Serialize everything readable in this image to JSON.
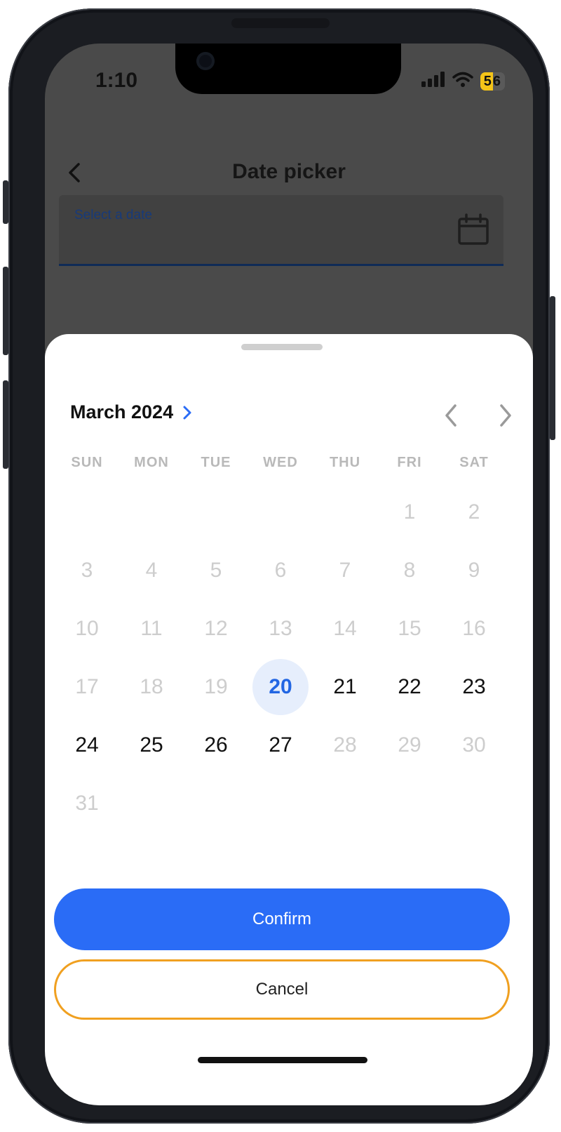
{
  "status_bar": {
    "time": "1:10",
    "battery_percent": "5",
    "battery_rest": "6",
    "signal_icon": "cellular-signal-icon",
    "wifi_icon": "wifi-icon"
  },
  "app_bar": {
    "title": "Date picker",
    "back_icon": "chevron-left-icon"
  },
  "date_field": {
    "label": "Select a date",
    "icon": "calendar-icon"
  },
  "colors": {
    "accent": "#2a6cf6",
    "selected_bg": "#e6eefc",
    "cancel_border": "#f0a020"
  },
  "picker": {
    "month_label": "March 2024",
    "weekdays": [
      "SUN",
      "MON",
      "TUE",
      "WED",
      "THU",
      "FRI",
      "SAT"
    ],
    "days": {
      "d1": "1",
      "d2": "2",
      "d3": "3",
      "d4": "4",
      "d5": "5",
      "d6": "6",
      "d7": "7",
      "d8": "8",
      "d9": "9",
      "d10": "10",
      "d11": "11",
      "d12": "12",
      "d13": "13",
      "d14": "14",
      "d15": "15",
      "d16": "16",
      "d17": "17",
      "d18": "18",
      "d19": "19",
      "d20": "20",
      "d21": "21",
      "d22": "22",
      "d23": "23",
      "d24": "24",
      "d25": "25",
      "d26": "26",
      "d27": "27",
      "d28": "28",
      "d29": "29",
      "d30": "30",
      "d31": "31"
    },
    "selected_day": "20",
    "enabled_days": [
      "20",
      "21",
      "22",
      "23",
      "24",
      "25",
      "26",
      "27"
    ],
    "confirm_label": "Confirm",
    "cancel_label": "Cancel"
  }
}
